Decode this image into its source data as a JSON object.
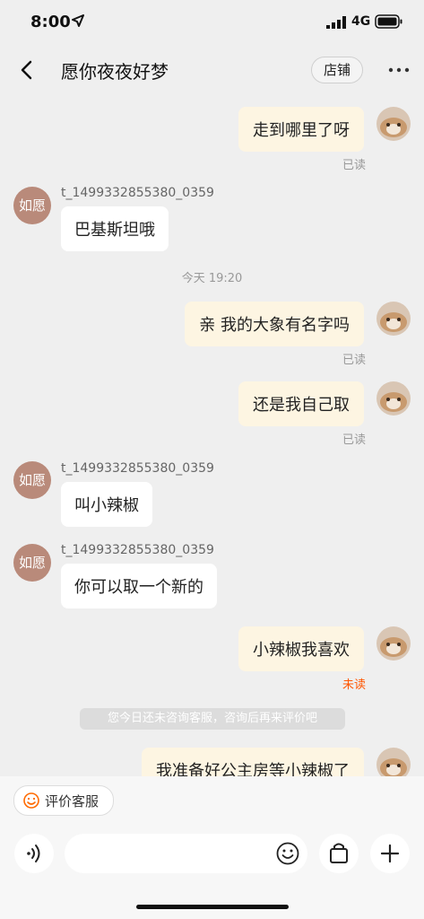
{
  "status_bar": {
    "time": "8:00",
    "network": "4G"
  },
  "nav": {
    "title": "愿你夜夜好梦",
    "shop_label": "店铺"
  },
  "messages": [
    {
      "text": "走到哪里了呀",
      "status": "已读"
    },
    {
      "sender": "t_1499332855380_0359",
      "avatar": "如愿",
      "text": "巴基斯坦哦"
    },
    {
      "timestamp": "今天 19:20"
    },
    {
      "text": "亲 我的大象有名字吗",
      "status": "已读"
    },
    {
      "text": "还是我自己取",
      "status": "已读"
    },
    {
      "sender": "t_1499332855380_0359",
      "avatar": "如愿",
      "text": "叫小辣椒"
    },
    {
      "sender": "t_1499332855380_0359",
      "avatar": "如愿",
      "text": "你可以取一个新的"
    },
    {
      "text": "小辣椒我喜欢",
      "status": "未读"
    },
    {
      "system": "您今日还未咨询客服，咨询后再来评价吧"
    },
    {
      "text": "我准备好公主房等小辣椒了"
    }
  ],
  "bottom": {
    "rate_label": "评价客服",
    "input_placeholder": ""
  },
  "colors": {
    "accent": "#ff5500",
    "outgoing_bubble": "#fdf5e2",
    "shop_avatar": "#b98a7a"
  }
}
